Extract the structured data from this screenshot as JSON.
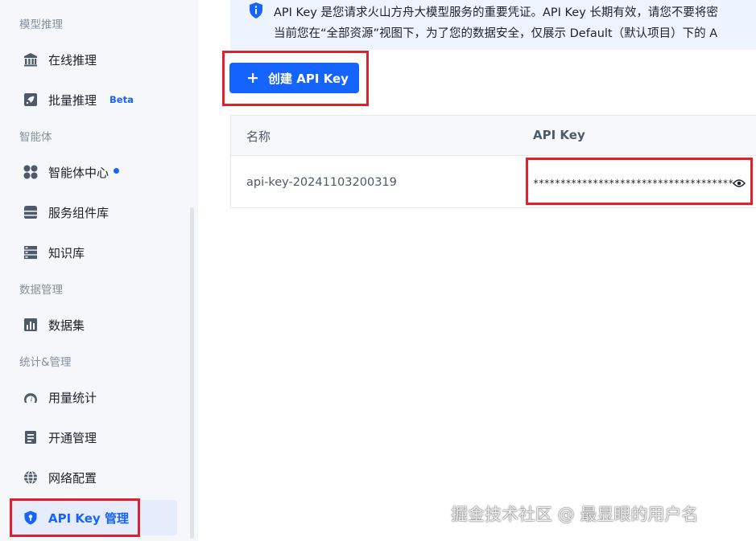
{
  "sidebar": {
    "sections": {
      "model_inference": "模型推理",
      "agents": "智能体",
      "data_management": "数据管理",
      "stats_management": "统计&管理"
    },
    "items": {
      "online_inference": "在线推理",
      "batch_inference": "批量推理",
      "batch_badge": "Beta",
      "agent_center": "智能体中心",
      "service_components": "服务组件库",
      "knowledge_base": "知识库",
      "datasets": "数据集",
      "usage_stats": "用量统计",
      "activation": "开通管理",
      "network": "网络配置",
      "api_key_mgmt": "API Key 管理"
    }
  },
  "banner": {
    "line1": "API Key 是您请求火山方舟大模型服务的重要凭证。API Key 长期有效，请您不要将密",
    "line2": "当前您在“全部资源”视图下，为了您的数据安全，仅展示 Default（默认项目）下的 A"
  },
  "create_button": {
    "label": "创建 API Key"
  },
  "table": {
    "columns": {
      "name": "名称",
      "api_key": "API Key"
    },
    "rows": [
      {
        "name": "api-key-20241103200319",
        "api_key": "*************************************"
      }
    ]
  },
  "watermark": "掘金技术社区 @ 最显眼的用户名",
  "colors": {
    "accent": "#1664ff",
    "highlight": "#e0202b",
    "sidebar_bg": "#f5f7fa"
  }
}
